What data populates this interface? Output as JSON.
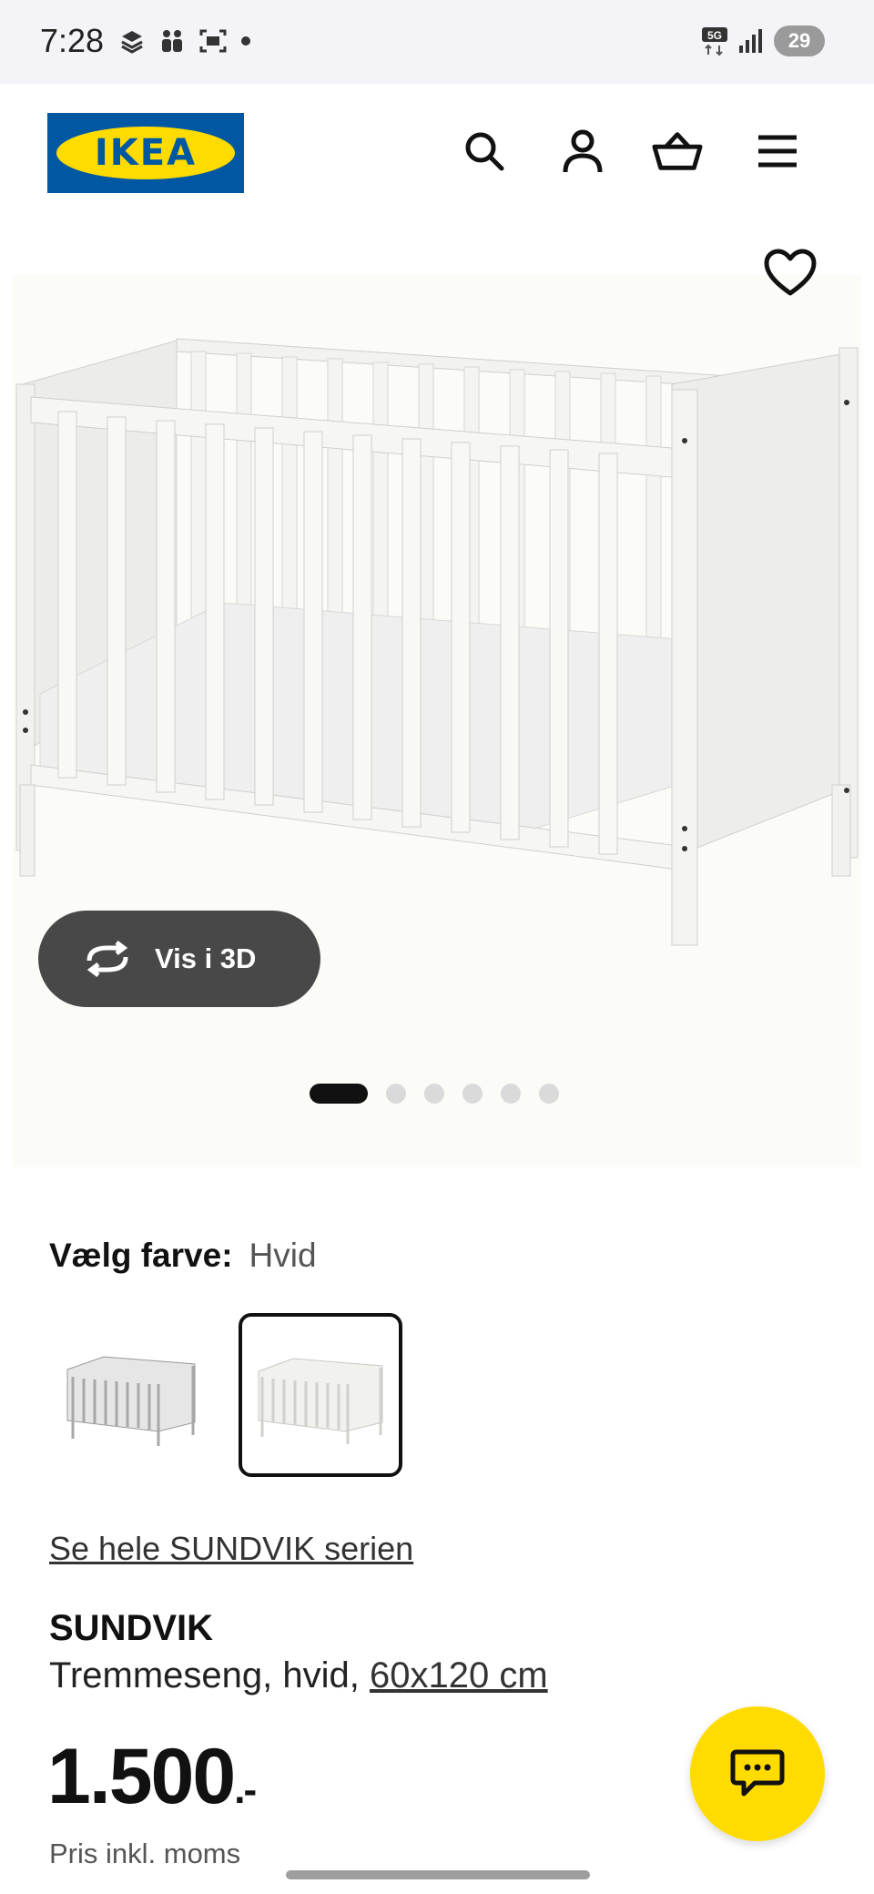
{
  "status_bar": {
    "time": "7:28",
    "network": "5G",
    "battery": "29"
  },
  "header": {
    "logo_text": "IKEA",
    "icons": [
      "search-icon",
      "profile-icon",
      "basket-icon",
      "menu-icon"
    ]
  },
  "gallery": {
    "view_3d_label": "Vis i 3D",
    "dots_total": 6,
    "active_dot": 1
  },
  "color": {
    "label": "Vælg farve:",
    "value": "Hvid"
  },
  "series_link": "Se hele SUNDVIK serien",
  "product": {
    "name": "SUNDVIK",
    "description": "Tremmeseng, hvid,",
    "size": "60x120 cm",
    "price": "1.500",
    "price_suffix": ".-",
    "price_note": "Pris inkl. moms"
  },
  "colors": {
    "brand_blue": "#0058a3",
    "brand_yellow": "#ffdb00"
  }
}
